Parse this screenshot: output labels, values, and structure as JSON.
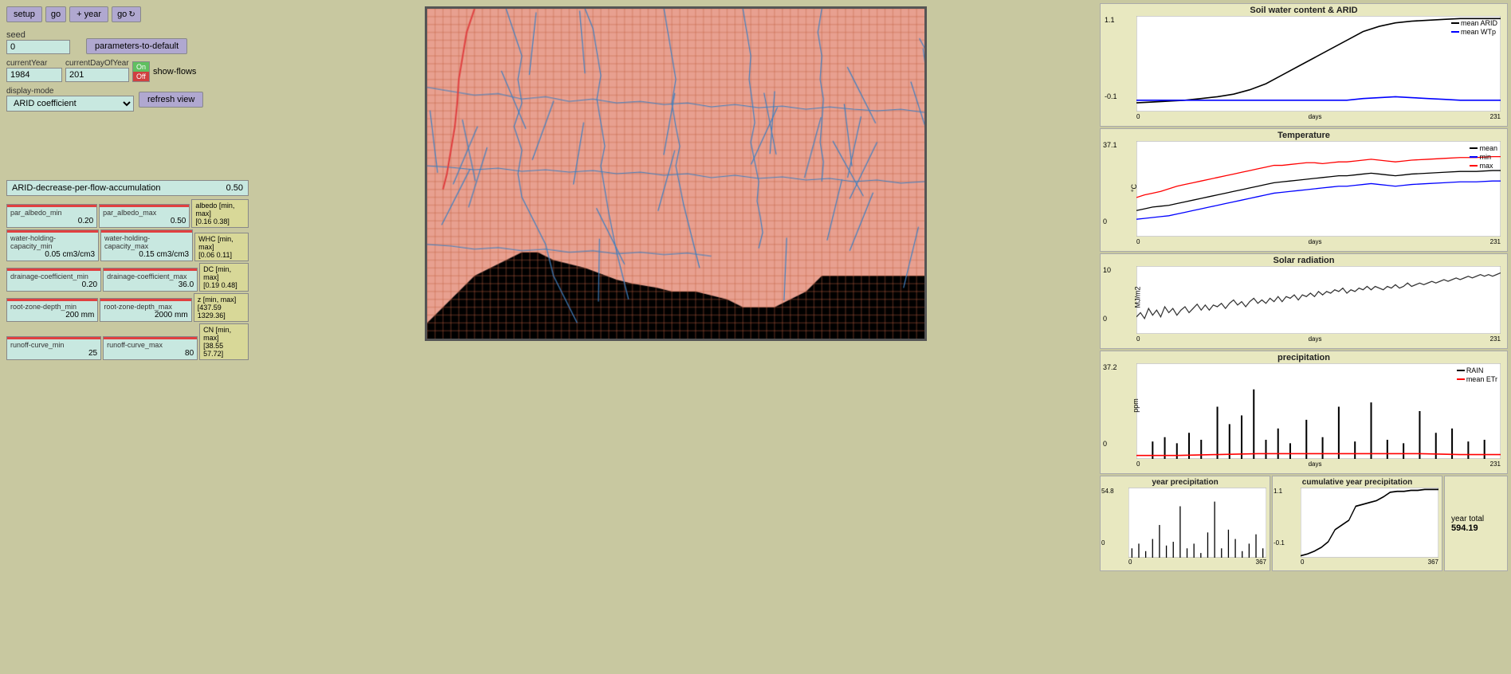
{
  "controls": {
    "setup_label": "setup",
    "go_label": "go",
    "year_label": "+ year",
    "go2_label": "go",
    "seed_label": "seed",
    "seed_value": "0",
    "params_default_label": "parameters-to-default",
    "current_year_label": "currentYear",
    "current_year_value": "1984",
    "current_day_label": "currentDayOfYear",
    "current_day_value": "201",
    "on_label": "On",
    "off_label": "Off",
    "show_flows_label": "show-flows",
    "display_mode_label": "display-mode",
    "display_mode_value": "ARID coefficient",
    "refresh_label": "refresh view"
  },
  "params": {
    "arid_label": "ARID-decrease-per-flow-accumulation",
    "arid_value": "0.50",
    "par_albedo_min_label": "par_albedo_min",
    "par_albedo_min_value": "0.20",
    "par_albedo_max_label": "par_albedo_max",
    "par_albedo_max_value": "0.50",
    "albedo_range_label": "albedo [min, max]",
    "albedo_range_value": "[0.16 0.38]",
    "whc_min_label": "water-holding-capacity_min",
    "whc_min_value": "0.05 cm3/cm3",
    "whc_max_label": "water-holding-capacity_max",
    "whc_max_value": "0.15 cm3/cm3",
    "whc_range_label": "WHC [min, max]",
    "whc_range_value": "[0.06 0.11]",
    "dc_min_label": "drainage-coefficient_min",
    "dc_min_value": "0.20",
    "dc_max_label": "drainage-coefficient_max",
    "dc_max_value": "36.0",
    "dc_range_label": "DC [min, max]",
    "dc_range_value": "[0.19 0.48]",
    "z_min_label": "root-zone-depth_min",
    "z_min_value": "200 mm",
    "z_max_label": "root-zone-depth_max",
    "z_max_value": "2000 mm",
    "z_range_label": "z [min, max]",
    "z_range_value": "[437.59 1329.36]",
    "cn_min_label": "runoff-curve_min",
    "cn_min_value": "25",
    "cn_max_label": "runoff-curve_max",
    "cn_max_value": "80",
    "cn_range_label": "CN [min, max]",
    "cn_range_value": "[38.55 57.72]"
  },
  "charts": {
    "soil_water_title": "Soil water content & ARID",
    "soil_water_y_max": "1.1",
    "soil_water_y_min": "-0.1",
    "soil_water_x_max": "231",
    "soil_water_legend_arid": "mean ARID",
    "soil_water_legend_wtp": "mean WTp",
    "temperature_title": "Temperature",
    "temperature_y_max": "37.1",
    "temperature_y_min": "0",
    "temperature_x_max": "231",
    "temperature_y_label": "°C",
    "temperature_legend_mean": "mean",
    "temperature_legend_min": "min",
    "temperature_legend_max": "max",
    "solar_title": "Solar radiation",
    "solar_y_max": "10",
    "solar_y_min": "0",
    "solar_x_max": "231",
    "solar_y_label": "MJ/m2",
    "precipitation_title": "precipitation",
    "precip_y_max": "37.2",
    "precip_y_min": "0",
    "precip_x_max": "231",
    "precip_y_label": "ppm",
    "precip_legend_rain": "RAIN",
    "precip_legend_etr": "mean ETr",
    "year_precip_title": "year precipitation",
    "year_precip_y_max": "54.8",
    "year_precip_y_min": "0",
    "year_precip_x_max": "367",
    "cum_precip_title": "cumulative year precipitation",
    "cum_precip_y_max": "1.1",
    "cum_precip_y_min": "-0.1",
    "cum_precip_x_max": "367",
    "year_total_label": "year total",
    "year_total_value": "594.19",
    "days_label": "days"
  }
}
